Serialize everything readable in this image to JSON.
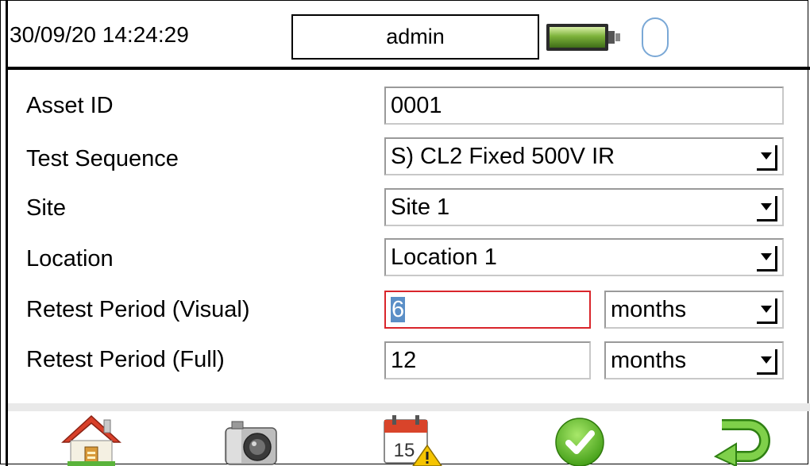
{
  "header": {
    "datetime": "30/09/20 14:24:29",
    "user": "admin",
    "battery_icon": "battery-icon",
    "indicator_icon": "capsule-indicator-icon"
  },
  "form": {
    "asset_id": {
      "label": "Asset ID",
      "value": "0001"
    },
    "test_sequence": {
      "label": "Test Sequence",
      "value": "S) CL2 Fixed 500V IR"
    },
    "site": {
      "label": "Site",
      "value": "Site 1"
    },
    "location": {
      "label": "Location",
      "value": "Location 1"
    },
    "retest_visual": {
      "label": "Retest Period (Visual)",
      "value": "6",
      "unit": "months"
    },
    "retest_full": {
      "label": "Retest Period (Full)",
      "value": "12",
      "unit": "months"
    }
  },
  "toolbar": {
    "items": [
      "home-icon",
      "camera-icon",
      "calendar-warning-icon",
      "confirm-icon",
      "back-icon"
    ],
    "calendar_day": "15"
  },
  "colors": {
    "error_border": "#d9252b",
    "selection": "#5b8fc7",
    "confirm_green": "#4bb31c",
    "back_green": "#5fb82a"
  }
}
